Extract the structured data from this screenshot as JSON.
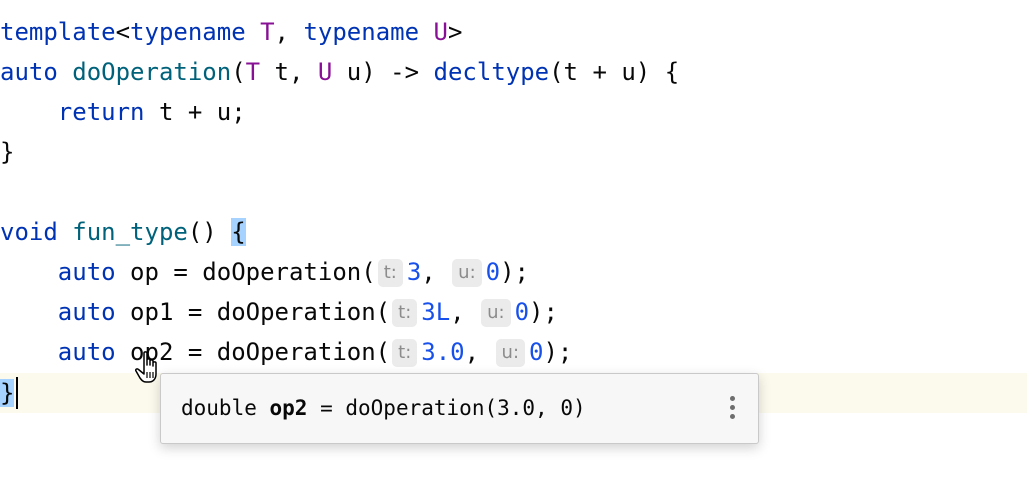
{
  "code": {
    "line1": {
      "template_kw": "template",
      "lt": "<",
      "typename1": "typename",
      "t_param": "T",
      "comma": ", ",
      "typename2": "typename",
      "u_param": "U",
      "gt": ">"
    },
    "line2": {
      "auto_kw": "auto",
      "fn_name": "doOperation",
      "open": "(",
      "t_type": "T",
      "t_arg": " t, ",
      "u_type": "U",
      "u_arg": " u) -> ",
      "decltype_kw": "decltype",
      "rest": "(t + u) {"
    },
    "line3": {
      "return_kw": "return",
      "expr": " t + u;"
    },
    "line4": {
      "close": "}"
    },
    "line6": {
      "void_kw": "void",
      "fn_name": "fun_type",
      "parens": "() ",
      "brace": "{"
    },
    "line7": {
      "auto_kw": "auto",
      "mid": " op = doOperation(",
      "hint_t": "t:",
      "arg_t": "3",
      "sep": ", ",
      "hint_u": "u:",
      "arg_u": "0",
      "end": ");"
    },
    "line8": {
      "auto_kw": "auto",
      "mid": " op1 = doOperation(",
      "hint_t": "t:",
      "arg_t": "3L",
      "sep": ", ",
      "hint_u": "u:",
      "arg_u": "0",
      "end": ");"
    },
    "line9": {
      "auto_kw": "auto",
      "mid": " op2 = doOperation(",
      "hint_t": "t:",
      "arg_t": "3.0",
      "sep": ", ",
      "hint_u": "u:",
      "arg_u": "0",
      "end": ");"
    },
    "line10": {
      "close": "}"
    }
  },
  "popup": {
    "type": "double",
    "var": "op2",
    "rest": " = doOperation(3.0, 0)",
    "menu_icon": "more-vertical-icon"
  },
  "colors": {
    "keyword": "#0033b3",
    "type_param": "#871094",
    "function": "#00627a",
    "number": "#1750eb",
    "brace_highlight": "#a6d2ff",
    "caret_line": "#fcfaed"
  }
}
